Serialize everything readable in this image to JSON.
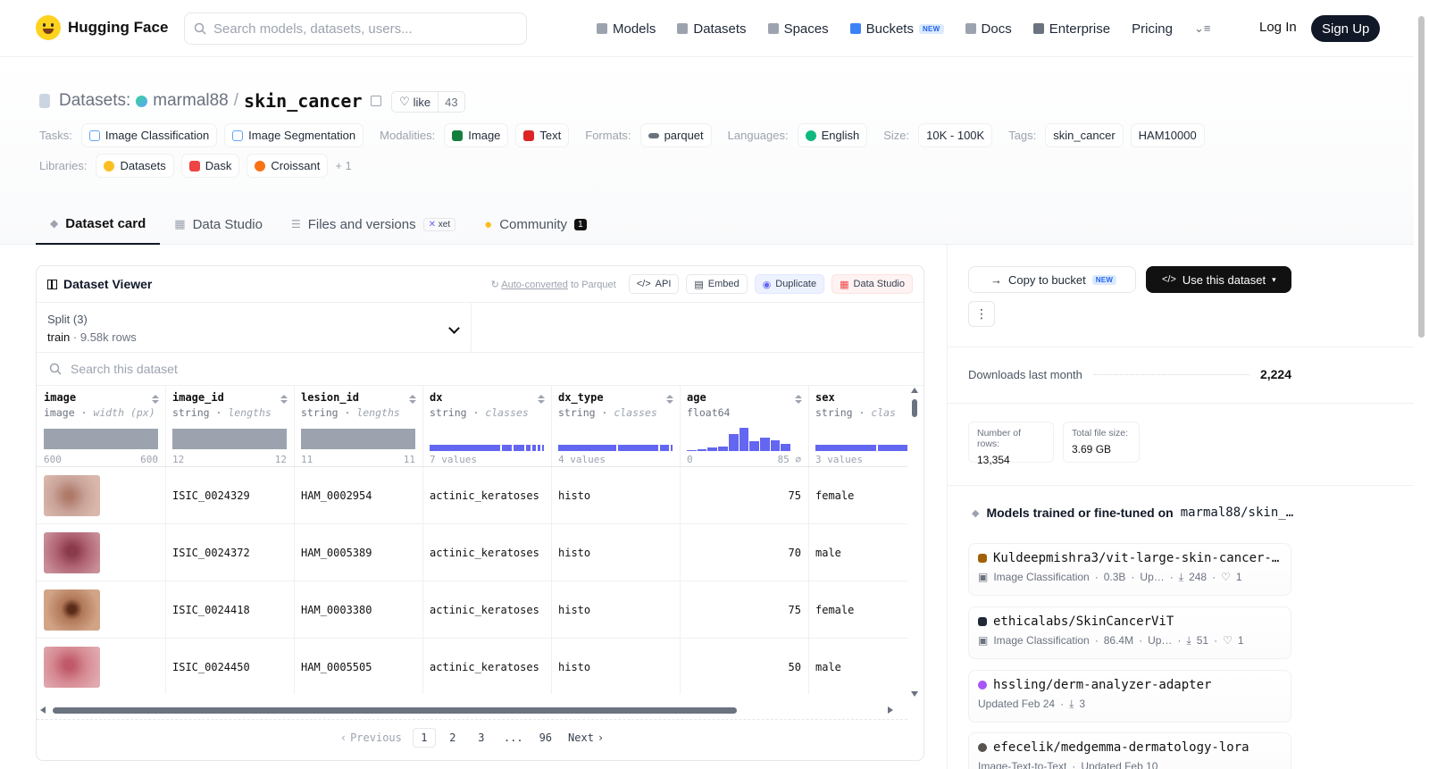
{
  "nav": {
    "brand": "Hugging Face",
    "search_placeholder": "Search models, datasets, users...",
    "links": [
      "Models",
      "Datasets",
      "Spaces",
      "Buckets",
      "Docs",
      "Enterprise",
      "Pricing"
    ],
    "new_badge": "NEW",
    "login": "Log In",
    "signup": "Sign Up"
  },
  "header": {
    "section": "Datasets:",
    "owner": "marmal88",
    "slash": "/",
    "repo": "skin_cancer",
    "like_label": "like",
    "like_count": "43",
    "tasks_label": "Tasks:",
    "tasks": [
      "Image Classification",
      "Image Segmentation"
    ],
    "modalities_label": "Modalities:",
    "modalities": [
      "Image",
      "Text"
    ],
    "formats_label": "Formats:",
    "formats": [
      "parquet"
    ],
    "languages_label": "Languages:",
    "languages": [
      "English"
    ],
    "size_label": "Size:",
    "size": "10K - 100K",
    "tags_label": "Tags:",
    "tags": [
      "skin_cancer",
      "HAM10000"
    ],
    "libraries_label": "Libraries:",
    "libraries": [
      "Datasets",
      "Dask",
      "Croissant"
    ],
    "libraries_more": "+ 1"
  },
  "tabs": {
    "dataset_card": "Dataset card",
    "data_studio": "Data Studio",
    "files": "Files and versions",
    "xet": "xet",
    "community": "Community",
    "community_count": "1"
  },
  "viewer": {
    "title": "Dataset Viewer",
    "auto_converted": "Auto-converted",
    "to_parquet": " to Parquet",
    "api": "API",
    "embed": "Embed",
    "duplicate": "Duplicate",
    "data_studio": "Data Studio",
    "split_label": "Split (3)",
    "split_value": "train",
    "split_rows": "9.58k rows",
    "search_placeholder": "Search this dataset",
    "columns": [
      {
        "name": "image",
        "type": "image",
        "stat": "width (px)",
        "min": "600",
        "max": "600"
      },
      {
        "name": "image_id",
        "type": "string",
        "stat": "lengths",
        "min": "12",
        "max": "12"
      },
      {
        "name": "lesion_id",
        "type": "string",
        "stat": "lengths",
        "min": "11",
        "max": "11"
      },
      {
        "name": "dx",
        "type": "string",
        "stat": "classes",
        "min": "7 values",
        "max": ""
      },
      {
        "name": "dx_type",
        "type": "string",
        "stat": "classes",
        "min": "4 values",
        "max": ""
      },
      {
        "name": "age",
        "type": "float64",
        "stat": "",
        "min": "0",
        "max": "85"
      },
      {
        "name": "sex",
        "type": "string",
        "stat": "clas",
        "min": "3 values",
        "max": ""
      }
    ],
    "rows": [
      {
        "image_id": "ISIC_0024329",
        "lesion_id": "HAM_0002954",
        "dx": "actinic_keratoses",
        "dx_type": "histo",
        "age": "75",
        "sex": "female"
      },
      {
        "image_id": "ISIC_0024372",
        "lesion_id": "HAM_0005389",
        "dx": "actinic_keratoses",
        "dx_type": "histo",
        "age": "70",
        "sex": "male"
      },
      {
        "image_id": "ISIC_0024418",
        "lesion_id": "HAM_0003380",
        "dx": "actinic_keratoses",
        "dx_type": "histo",
        "age": "75",
        "sex": "female"
      },
      {
        "image_id": "ISIC_0024450",
        "lesion_id": "HAM_0005505",
        "dx": "actinic_keratoses",
        "dx_type": "histo",
        "age": "50",
        "sex": "male"
      }
    ],
    "pager": {
      "previous": "Previous",
      "pages": [
        "1",
        "2",
        "3",
        "...",
        "96"
      ],
      "next": "Next"
    }
  },
  "sidebar": {
    "copy_to_bucket": "Copy to bucket",
    "new_badge": "NEW",
    "use_dataset": "Use this dataset",
    "downloads_label": "Downloads last month",
    "downloads": "2,224",
    "rows_label": "Number of rows:",
    "rows_value": "13,354",
    "size_label": "Total file size:",
    "size_value": "3.69 GB",
    "models_heading": "Models trained or fine-tuned on",
    "models_repo": "marmal88/skin_…",
    "models": [
      {
        "name": "Kuldeepmishra3/vit-large-skin-cancer-…",
        "meta": [
          "Image Classification",
          "0.3B",
          "Up…",
          "248",
          "1"
        ],
        "color": "#a16207"
      },
      {
        "name": "ethicalabs/SkinCancerViT",
        "meta": [
          "Image Classification",
          "86.4M",
          "Up…",
          "51",
          "1"
        ],
        "color": "#1f2937"
      },
      {
        "name": "hssling/derm-analyzer-adapter",
        "meta": [
          "Updated Feb 24",
          "3"
        ],
        "color": "#a855f7"
      },
      {
        "name": "efecelik/medgemma-dermatology-lora",
        "meta": [
          "Image-Text-to-Text",
          "Updated Feb 10"
        ],
        "color": "#57534e"
      }
    ]
  }
}
